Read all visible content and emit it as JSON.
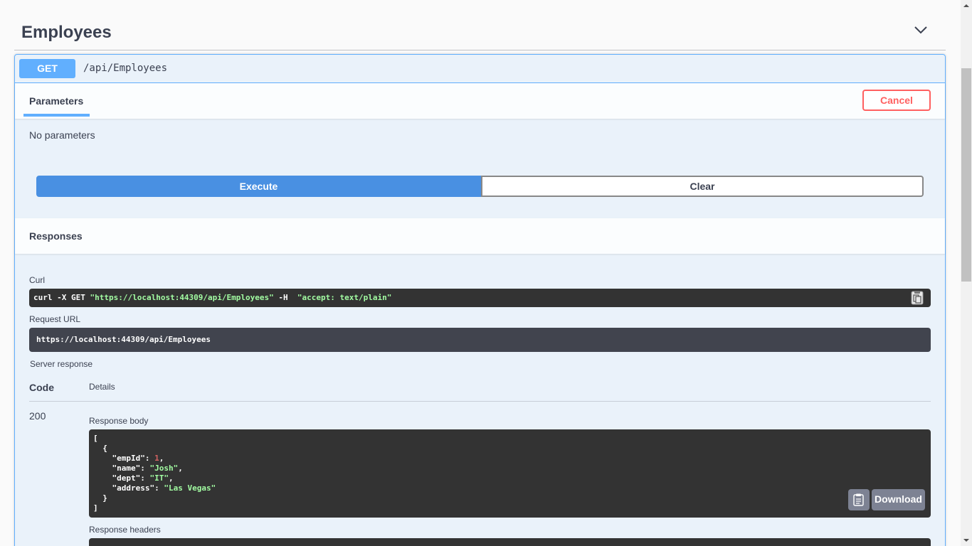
{
  "tag": {
    "title": "Employees",
    "chevron_icon": "chevron-down-icon"
  },
  "operation": {
    "method": "GET",
    "path": "/api/Employees",
    "colors": {
      "method": "#61affe",
      "execute": "#4990e2",
      "cancel": "#ff6060"
    }
  },
  "parameters": {
    "tab_label": "Parameters",
    "cancel_label": "Cancel",
    "empty_text": "No parameters"
  },
  "actions": {
    "execute_label": "Execute",
    "clear_label": "Clear"
  },
  "responses": {
    "title": "Responses",
    "curl_label": "Curl",
    "curl_cmd": "curl -X GET ",
    "curl_url": "\"https://localhost:44309/api/Employees\"",
    "curl_flag": " -H  ",
    "curl_header": "\"accept: text/plain\"",
    "request_url_label": "Request URL",
    "request_url": "https://localhost:44309/api/Employees",
    "server_response_label": "Server response",
    "code_header": "Code",
    "details_header": "Details",
    "status_code": "200",
    "response_body_label": "Response body",
    "response_body": {
      "open_bracket": "[",
      "open_brace": "  {",
      "fields": [
        {
          "key": "    \"empId\": ",
          "value": "1",
          "type": "num",
          "sep": ","
        },
        {
          "key": "    \"name\": ",
          "value": "\"Josh\"",
          "type": "str",
          "sep": ","
        },
        {
          "key": "    \"dept\": ",
          "value": "\"IT\"",
          "type": "str",
          "sep": ","
        },
        {
          "key": "    \"address\": ",
          "value": "\"Las Vegas\"",
          "type": "str",
          "sep": ""
        }
      ],
      "close_brace": "  }",
      "close_bracket": "]"
    },
    "download_label": "Download",
    "response_headers_label": "Response headers",
    "copy_icon": "clipboard-icon"
  }
}
